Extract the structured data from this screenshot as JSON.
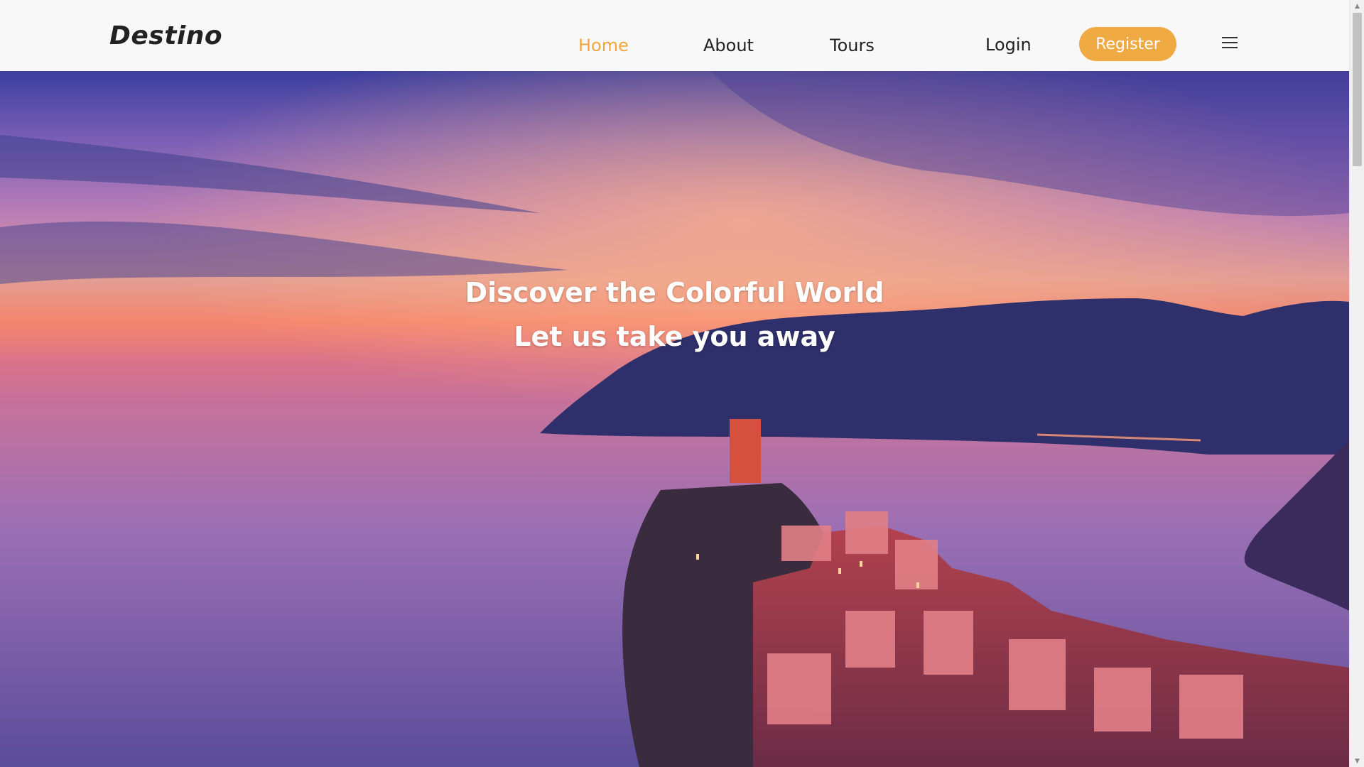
{
  "header": {
    "brand": "Destino",
    "nav": [
      {
        "label": "Home",
        "active": true
      },
      {
        "label": "About"
      },
      {
        "label": "Tours"
      }
    ],
    "login_label": "Login",
    "register_label": "Register",
    "menu_icon": "hamburger-menu-icon",
    "accent_color": "#efaa43"
  },
  "hero": {
    "title": "Discover the Colorful World",
    "subtitle": "Let us take you away"
  }
}
